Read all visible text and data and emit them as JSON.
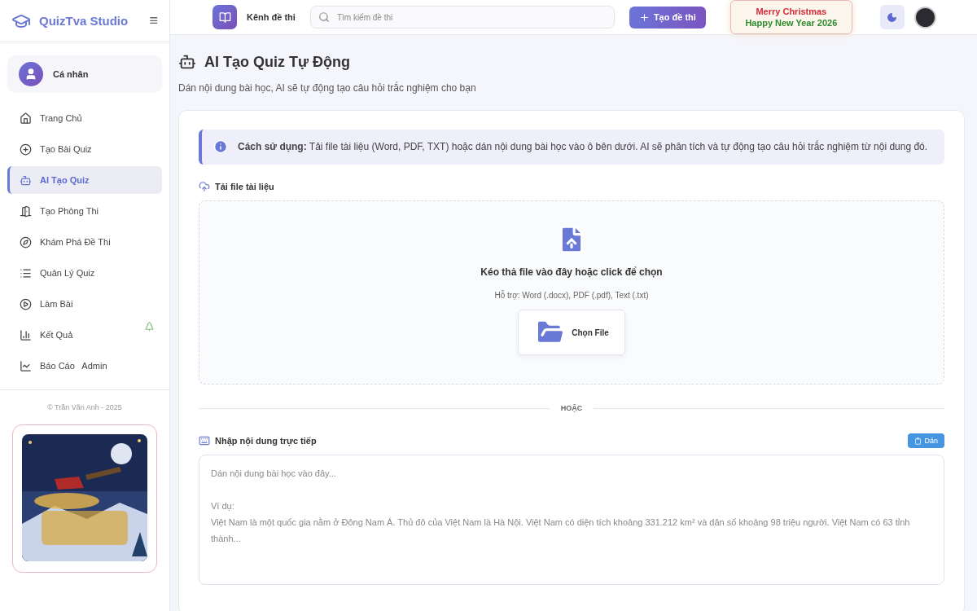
{
  "brand": {
    "name": "QuizTva Studio",
    "menu_glyph": "≡"
  },
  "profile": {
    "label": "Cá nhân"
  },
  "nav": [
    {
      "label": "Trang Chủ",
      "selected": false
    },
    {
      "label": "Tạo Bài Quiz",
      "selected": false
    },
    {
      "label": "AI Tạo Quiz",
      "selected": true
    },
    {
      "label": "Tạo Phòng Thi",
      "selected": false
    },
    {
      "label": "Khám Phá Đề Thi",
      "selected": false
    },
    {
      "label": "Quản Lý Quiz",
      "selected": false
    },
    {
      "label": "Làm Bài",
      "selected": false
    },
    {
      "label": "Kết Quả",
      "selected": false
    },
    {
      "label": "Báo Cáo   Admin",
      "selected": false
    }
  ],
  "footer": {
    "copyright": "© Trần Văn Anh - 2025"
  },
  "topbar": {
    "channel": "Kênh đề thi",
    "search_placeholder": "Tìm kiếm đề thi",
    "create_button": "Tạo đề thi",
    "greeting": [
      "Merry Christmas",
      "Happy New Year 2026"
    ]
  },
  "page": {
    "title": "AI Tạo Quiz Tự Động",
    "subtitle": "Dán nội dung bài học, AI sẽ tự động tạo câu hỏi trắc nghiệm cho bạn",
    "info": "**Cách sử dụng:** Tải file tài liệu (Word, PDF, TXT) hoặc dán nội dung bài học vào ô bên dưới. AI sẽ phân tích và tự động tạo câu hỏi trắc nghiệm từ nội dung đó.",
    "upload": {
      "heading": "Tải file tài liệu",
      "prompt": "Kéo thả file vào đây hoặc click để chọn",
      "support": "Hỗ trợ: Word (.docx), PDF (.pdf), Text (.txt)",
      "button": "Chọn File"
    },
    "divider": "HOẶC",
    "direct": {
      "heading": "Nhập nội dung trực tiếp",
      "paste_button": "Dán",
      "placeholder": "Dán nội dung bài học vào đây...\n\nVí dụ:\nViệt Nam là một quốc gia nằm ở Đông Nam Á. Thủ đô của Việt Nam là Hà Nội. Việt Nam có diện tích khoảng 331.212 km² và dân số khoảng 98 triệu người. Việt Nam có 63 tỉnh thành..."
    }
  }
}
